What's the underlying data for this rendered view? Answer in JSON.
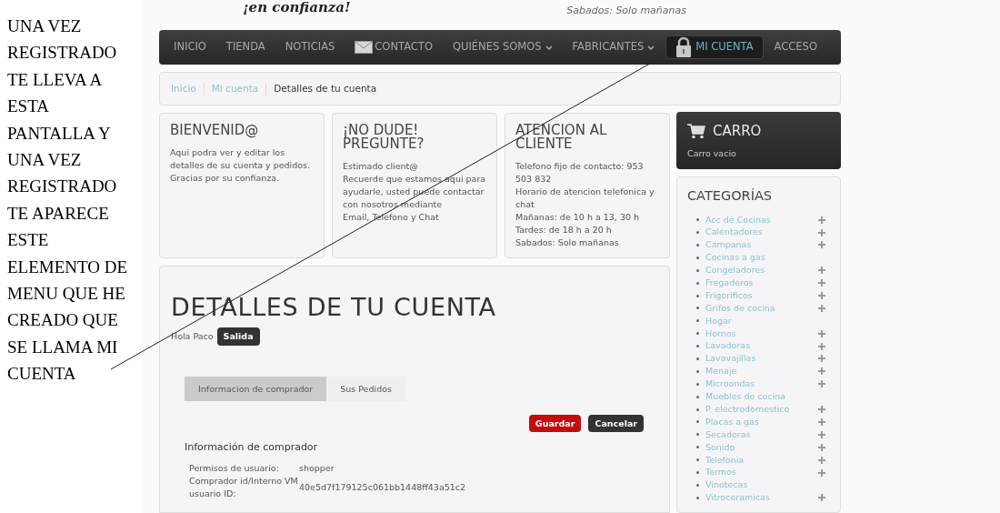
{
  "annotation": {
    "text": "UNA VEZ REGISTRADO TE LLEVA A ESTA PANTALLA Y UNA VEZ REGISTRADO TE APARECE ESTE ELEMENTO DE MENU QUE HE CREADO QUE SE LLAMA MI CUENTA"
  },
  "header": {
    "slogan": "¡en confianza!",
    "hours": "Sabados: Solo mañanas"
  },
  "nav": [
    {
      "label": "INICIO",
      "kind": "plain",
      "dropdown": false,
      "selected": false
    },
    {
      "label": "TIENDA",
      "kind": "plain",
      "dropdown": false,
      "selected": false
    },
    {
      "label": "NOTICIAS",
      "kind": "plain",
      "dropdown": false,
      "selected": false
    },
    {
      "label": "CONTACTO",
      "kind": "mail",
      "dropdown": false,
      "selected": false
    },
    {
      "label": "QUIÉNES SOMOS",
      "kind": "plain",
      "dropdown": true,
      "selected": false
    },
    {
      "label": "FABRICANTES",
      "kind": "plain",
      "dropdown": true,
      "selected": false
    },
    {
      "label": "MI CUENTA",
      "kind": "lock",
      "dropdown": false,
      "selected": true
    },
    {
      "label": "ACCESO",
      "kind": "plain",
      "dropdown": false,
      "selected": false
    }
  ],
  "breadcrumb": [
    {
      "label": "Inicio",
      "kind": "link"
    },
    {
      "label": "Mi cuenta",
      "kind": "link"
    },
    {
      "label": "Detalles de tu cuenta",
      "kind": "current"
    }
  ],
  "info_cards": [
    {
      "title": "BIENVENID@",
      "lines": [
        "Aqui podra ver y editar los detalles de su cuenta y pedidos.",
        "Gracias por su confianza."
      ]
    },
    {
      "title": "¡NO DUDE! PREGUNTE?",
      "lines": [
        "Estimado client@",
        "Recuerde que estamos aqui para ayudarle, usted puede contactar con nosotros mediante",
        "Email, Telefono y Chat"
      ]
    },
    {
      "title": "ATENCION AL CLIENTE",
      "lines": [
        "Telefono fijo de contacto: 953 503 832",
        "Horario de atencion telefonica y chat",
        "Mañanas: de 10 h a 13, 30 h",
        "Tardes: de 18 h a 20 h",
        "Sabados: Solo mañanas"
      ]
    }
  ],
  "account": {
    "title": "DETALLES DE TU CUENTA",
    "greeting": "Hola Paco",
    "logout": "Salida",
    "tabs": [
      {
        "label": "Informacion de comprador",
        "selected": true
      },
      {
        "label": "Sus Pedidos",
        "selected": false
      }
    ],
    "buttons": [
      {
        "label": "Guardar",
        "kind": "primary"
      },
      {
        "label": "Cancelar",
        "kind": "secondary"
      }
    ],
    "section_title": "Información de comprador",
    "fields": [
      {
        "label": "Permisos de usuario:",
        "value": "shopper"
      },
      {
        "label": "Comprador id/Interno VM usuario ID:",
        "value": "40e5d7f179125c061bb1448ff43a51c2"
      }
    ]
  },
  "cart": {
    "title": "CARRO",
    "status": "Carro vacio"
  },
  "categories": {
    "title": "CATEGORÍAS",
    "items": [
      {
        "label": "Acc de Cocinas",
        "expandable": true
      },
      {
        "label": "Calentadores",
        "expandable": true
      },
      {
        "label": "Campanas",
        "expandable": true
      },
      {
        "label": "Cocinas a gas",
        "expandable": false
      },
      {
        "label": "Congeladores",
        "expandable": true
      },
      {
        "label": "Fregaderos",
        "expandable": true
      },
      {
        "label": "Frigorificos",
        "expandable": true
      },
      {
        "label": "Grifos de cocina",
        "expandable": true
      },
      {
        "label": "Hogar",
        "expandable": false
      },
      {
        "label": "Hornos",
        "expandable": true
      },
      {
        "label": "Lavadoras",
        "expandable": true
      },
      {
        "label": "Lavavajillas",
        "expandable": true
      },
      {
        "label": "Menaje",
        "expandable": true
      },
      {
        "label": "Microondas",
        "expandable": true
      },
      {
        "label": "Muebles de cocina",
        "expandable": false
      },
      {
        "label": "P. electrodomestico",
        "expandable": true
      },
      {
        "label": "Placas a gas",
        "expandable": true
      },
      {
        "label": "Secadoras",
        "expandable": true
      },
      {
        "label": "Sonido",
        "expandable": true
      },
      {
        "label": "Telefonia",
        "expandable": true
      },
      {
        "label": "Termos",
        "expandable": true
      },
      {
        "label": "Vinotecas",
        "expandable": false
      },
      {
        "label": "Vitroceramicas",
        "expandable": true
      }
    ]
  }
}
